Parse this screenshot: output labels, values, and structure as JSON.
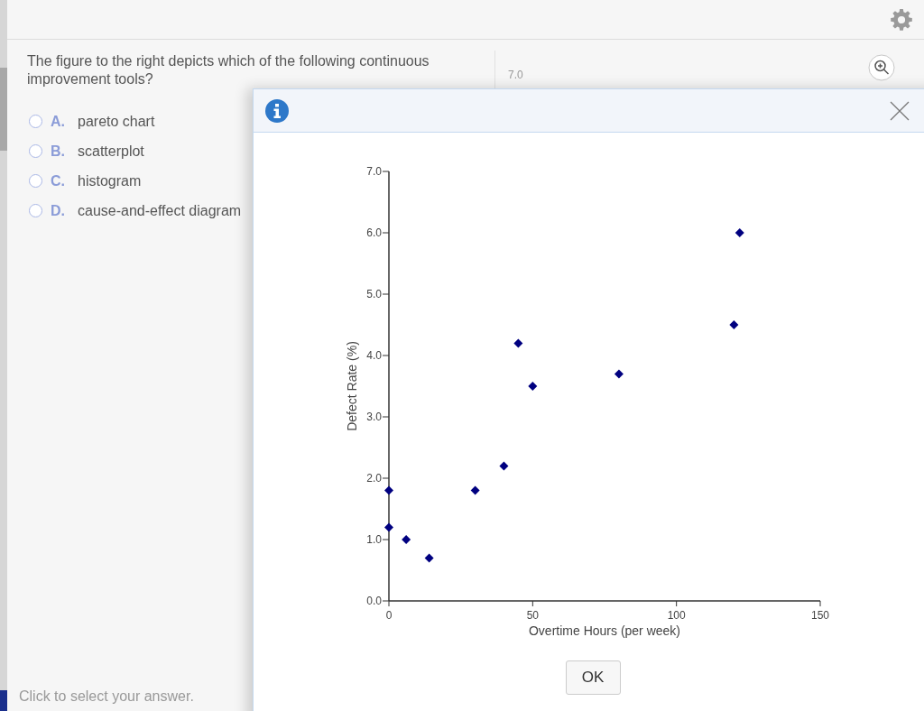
{
  "question": "The figure to the right depicts which of the following continuous improvement tools?",
  "options": [
    {
      "letter": "A.",
      "text": "pareto chart",
      "selected": false
    },
    {
      "letter": "B.",
      "text": "scatterplot",
      "selected": false
    },
    {
      "letter": "C.",
      "text": "histogram",
      "selected": false
    },
    {
      "letter": "D.",
      "text": "cause-and-effect diagram",
      "selected": false
    }
  ],
  "instruction": "Click to select your answer.",
  "background_figure_label": "7.0",
  "dialog": {
    "chart_data": {
      "type": "scatter",
      "xlabel": "Overtime Hours (per week)",
      "ylabel": "Defect Rate (%)",
      "x": [
        0,
        0,
        6,
        14,
        30,
        40,
        45,
        50,
        80,
        120,
        122
      ],
      "series": [
        {
          "color": "#000080",
          "values": [
            1.8,
            1.2,
            1.0,
            0.7,
            1.8,
            2.2,
            4.2,
            3.5,
            3.7,
            4.5,
            6.0
          ]
        }
      ],
      "xlim": [
        0,
        150
      ],
      "ylim": [
        0,
        7
      ],
      "xticks": [
        0,
        50,
        100,
        150
      ],
      "yticks": [
        {
          "value": 0,
          "label": "0.0"
        },
        {
          "value": 1,
          "label": "1.0"
        },
        {
          "value": 2,
          "label": "2.0"
        },
        {
          "value": 3,
          "label": "3.0"
        },
        {
          "value": 4,
          "label": "4.0"
        },
        {
          "value": 5,
          "label": "5.0"
        },
        {
          "value": 6,
          "label": "6.0"
        },
        {
          "value": 7,
          "label": "7.0"
        }
      ]
    },
    "ok_button": "OK"
  }
}
